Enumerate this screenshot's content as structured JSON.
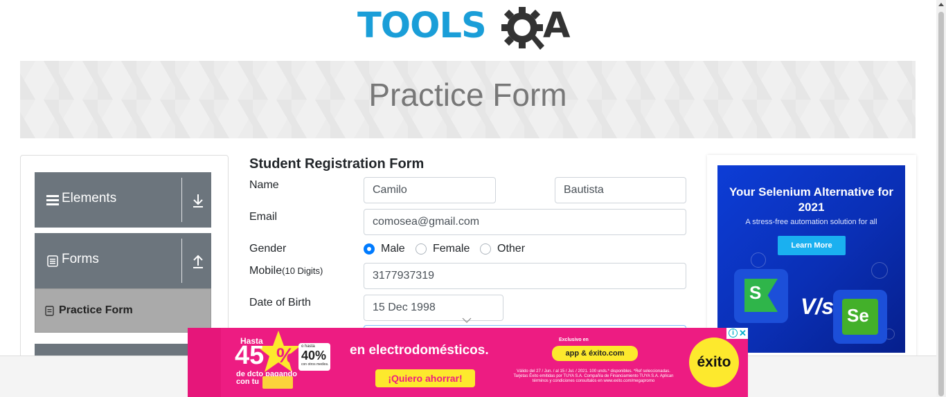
{
  "header": {
    "logo_main": "TOOLS",
    "logo_end": "A",
    "banner_title": "Practice Form"
  },
  "sidebar": {
    "groups": [
      {
        "label": "Elements",
        "icon": "hamburger-icon",
        "arrow": "download-arrow-icon"
      },
      {
        "label": "Forms",
        "icon": "document-icon",
        "arrow": "upload-arrow-icon"
      }
    ],
    "active_item": {
      "label": "Practice Form",
      "icon": "list-icon"
    }
  },
  "form": {
    "title": "Student Registration Form",
    "name_label": "Name",
    "first_name": "Camilo",
    "last_name": "Bautista",
    "email_label": "Email",
    "email": "comosea@gmail.com",
    "gender_label": "Gender",
    "gender_options": [
      "Male",
      "Female",
      "Other"
    ],
    "gender_selected": "Male",
    "mobile_label": "Mobile",
    "mobile_hint": "(10 Digits)",
    "mobile": "3177937319",
    "dob_label": "Date of Birth",
    "dob": "15 Dec 1998"
  },
  "side_ad": {
    "headline": "Your Selenium Alternative for 2021",
    "sub": "A stress-free automation solution for all",
    "button": "Learn More",
    "left_letter": "S",
    "vs": "V/s",
    "right_letter": "Se",
    "brand_blue": "#0d3dd6"
  },
  "bottom_ad": {
    "hasta": "Hasta",
    "percent": "45",
    "percent_sign": "%",
    "extra_small": "o hasta",
    "extra_pct": "40%",
    "extra_note": "con otros medios.",
    "dcto": "de dcto pagando con tu",
    "main_text": "en electrodomésticos.",
    "cta": "¡Quiero ahorrar!",
    "exclusive": "Exclusivo en",
    "app": "app & éxito.com",
    "legal": "Válido del 27 / Jun. / al 15 / Jul. / 2021. 100 unds.* disponibles. *Ref seleccionadas. Tarjetas Éxito emitidas por TUYA S.A. Compañía de Financiamiento TUYA S.A. Aplican términos y condiciones consultalos en www.exito.com/megapromo",
    "brand": "éxito",
    "brand_pink": "#ed1c82",
    "brand_yellow": "#fde92d"
  }
}
